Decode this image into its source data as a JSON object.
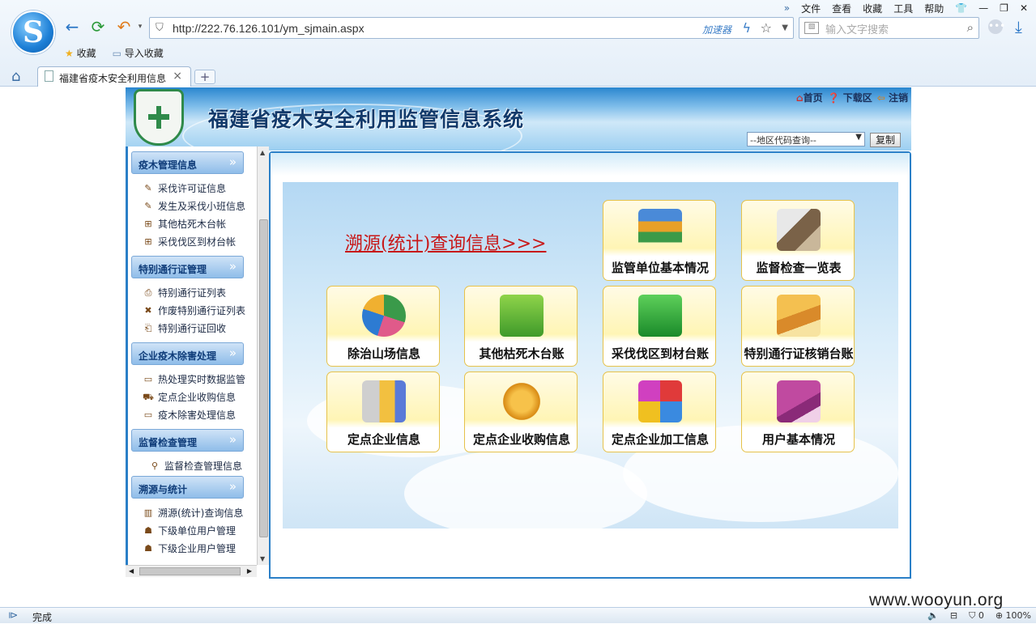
{
  "browser": {
    "menu": [
      "文件",
      "查看",
      "收藏",
      "工具",
      "帮助"
    ],
    "url": "http://222.76.126.101/ym_sjmain.aspx",
    "accelerator": "加速器",
    "search_placeholder": "输入文字搜索",
    "bookmarks": [
      "收藏",
      "导入收藏"
    ],
    "tab_title": "福建省疫木安全利用信息",
    "new_tab": "+"
  },
  "header": {
    "title": "福建省疫木安全利用监管信息系统",
    "links": {
      "home": "首页",
      "download": "下载区",
      "logout": "注销"
    },
    "region_select": "--地区代码查询--",
    "copy_button": "复制"
  },
  "sidebar": {
    "sections": [
      {
        "label": "疫木管理信息",
        "items": [
          "采伐许可证信息",
          "发生及采伐小班信息",
          "其他枯死木台帐",
          "采伐伐区到材台帐"
        ]
      },
      {
        "label": "特别通行证管理",
        "items": [
          "特别通行证列表",
          "作废特别通行证列表",
          "特别通行证回收"
        ]
      },
      {
        "label": "企业疫木除害处理",
        "items": [
          "热处理实时数据监管",
          "定点企业收购信息",
          "疫木除害处理信息"
        ]
      },
      {
        "label": "监督检查管理",
        "items": [
          "监督检查管理信息"
        ]
      },
      {
        "label": "溯源与统计",
        "items": [
          "溯源(统计)查询信息",
          "下级单位用户管理",
          "下级企业用户管理"
        ]
      }
    ]
  },
  "main": {
    "trace_link": "溯源(统计)查询信息>>>",
    "tiles": [
      "监管单位基本情况",
      "监督检查一览表",
      "除治山场信息",
      "其他枯死木台账",
      "采伐伐区到材台账",
      "特别通行证核销台账",
      "定点企业信息",
      "定点企业收购信息",
      "定点企业加工信息",
      "用户基本情况"
    ]
  },
  "status": {
    "text": "完成",
    "counter": "0",
    "zoom": "100%"
  },
  "watermark": "www.wooyun.org"
}
